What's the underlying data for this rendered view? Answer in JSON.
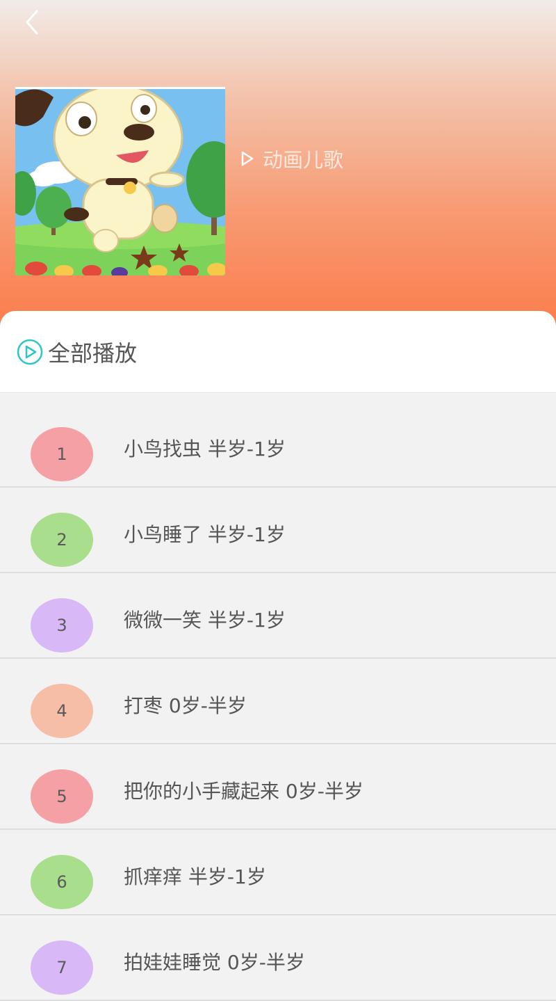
{
  "header": {
    "back_icon": "chevron-left-icon",
    "category_icon": "play-triangle-icon",
    "category_label": "动画儿歌"
  },
  "play_all": {
    "icon": "play-circle-icon",
    "label": "全部播放",
    "accent_color": "#2ec5c8"
  },
  "songs": [
    {
      "number": "1",
      "title": "小鸟找虫 半岁-1岁",
      "badge_color": "#f4a0a4"
    },
    {
      "number": "2",
      "title": "小鸟睡了 半岁-1岁",
      "badge_color": "#a8de8c"
    },
    {
      "number": "3",
      "title": "微微一笑 半岁-1岁",
      "badge_color": "#d8b8f6"
    },
    {
      "number": "4",
      "title": "打枣 0岁-半岁",
      "badge_color": "#f6bea6"
    },
    {
      "number": "5",
      "title": "把你的小手藏起来 0岁-半岁",
      "badge_color": "#f4a0a4"
    },
    {
      "number": "6",
      "title": "抓痒痒 半岁-1岁",
      "badge_color": "#a8de8c"
    },
    {
      "number": "7",
      "title": "拍娃娃睡觉 0岁-半岁",
      "badge_color": "#d8b8f6"
    }
  ]
}
